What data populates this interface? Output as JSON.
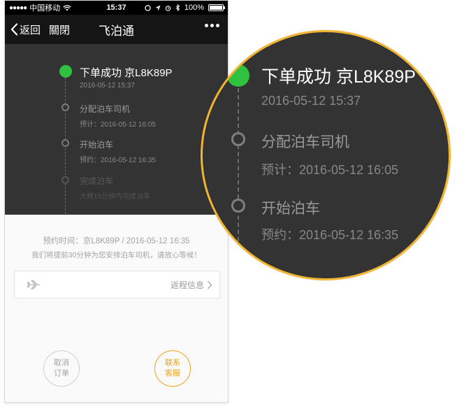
{
  "status_bar": {
    "carrier": "中国移动",
    "time": "15:37",
    "battery": "100%",
    "battery_level": 1.0
  },
  "nav": {
    "back_label": "返回",
    "close_label": "關閉",
    "title": "飞泊通"
  },
  "timeline": [
    {
      "title": "下单成功 京L8K89P",
      "subtitle": "2016-05-12 15:37",
      "state": "done"
    },
    {
      "title": "分配泊车司机",
      "subtitle": "预计：2016-05-12 16:05",
      "state": "pending"
    },
    {
      "title": "开始泊车",
      "subtitle": "预约：2016-05-12 16:35",
      "state": "pending"
    },
    {
      "title": "完成泊车",
      "subtitle": "大概15分钟内完成泊车",
      "state": "future"
    }
  ],
  "info": {
    "reservation": "预约时间：京L8K89P / 2016-05-12 16:35",
    "notice": "我们将提前30分钟为您安排泊车司机，请放心等候！",
    "return_label": "返程信息"
  },
  "actions": {
    "cancel_line1": "取消",
    "cancel_line2": "订单",
    "contact_line1": "联系",
    "contact_line2": "客服"
  },
  "magnifier": {
    "items": [
      {
        "title": "下单成功 京L8K89P",
        "subtitle": "2016-05-12 15:37"
      },
      {
        "title": "分配泊车司机",
        "subtitle": "预计：2016-05-12 16:05"
      },
      {
        "title": "开始泊车",
        "subtitle": "预约：2016-05-12 16:35"
      }
    ]
  },
  "colors": {
    "success": "#2fc23e",
    "accent": "#f0a21a",
    "magnifier_border": "#f2b531",
    "panel_dark": "#333333"
  },
  "icons": [
    "chevron-left-icon",
    "more-icon",
    "airplane-icon",
    "chevron-right-icon",
    "wifi-icon",
    "signal-icon",
    "location-icon",
    "alarm-icon",
    "bluetooth-icon",
    "battery-icon"
  ]
}
